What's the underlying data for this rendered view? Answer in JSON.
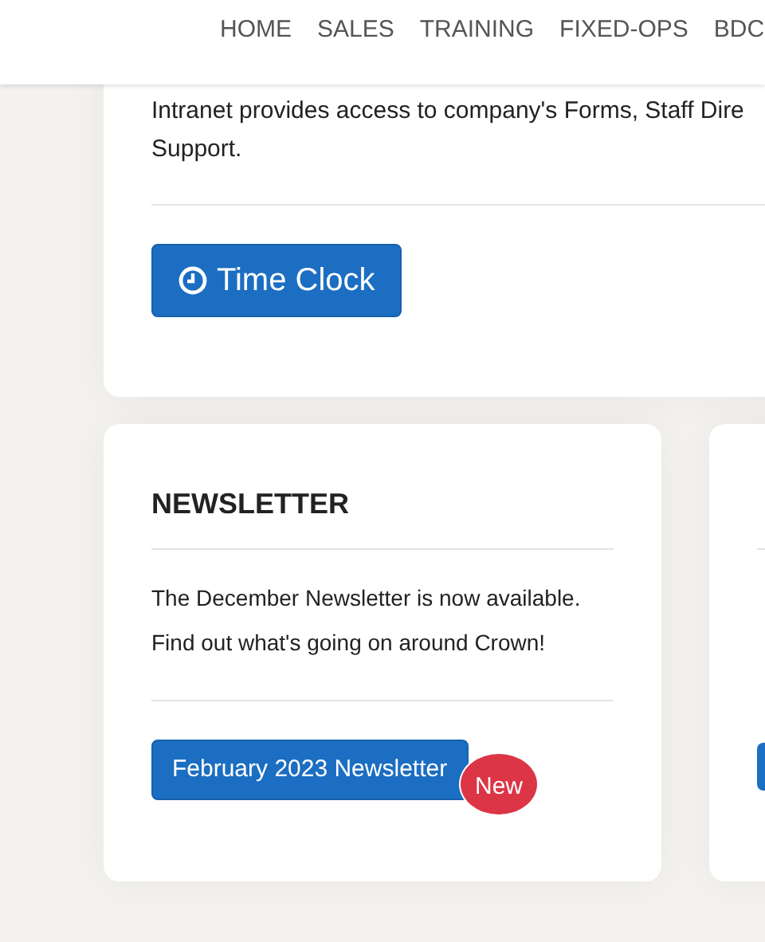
{
  "nav": {
    "items": [
      {
        "label": "HOME"
      },
      {
        "label": "SALES"
      },
      {
        "label": "TRAINING"
      },
      {
        "label": "FIXED-OPS"
      },
      {
        "label": "BDC"
      }
    ]
  },
  "intro": {
    "lines": [
      "Intranet provides access to company's Forms, Staff Dire",
      "Support."
    ],
    "button": {
      "label": "Time Clock"
    }
  },
  "cards": [
    {
      "kind": "full",
      "heading": "NEWSLETTER",
      "lines": [
        "The December Newsletter is now available.",
        "Find out what's going on around Crown!"
      ],
      "button": {
        "label": "February 2023 Newsletter"
      },
      "badge": "New"
    },
    {
      "kind": "cut"
    }
  ]
}
